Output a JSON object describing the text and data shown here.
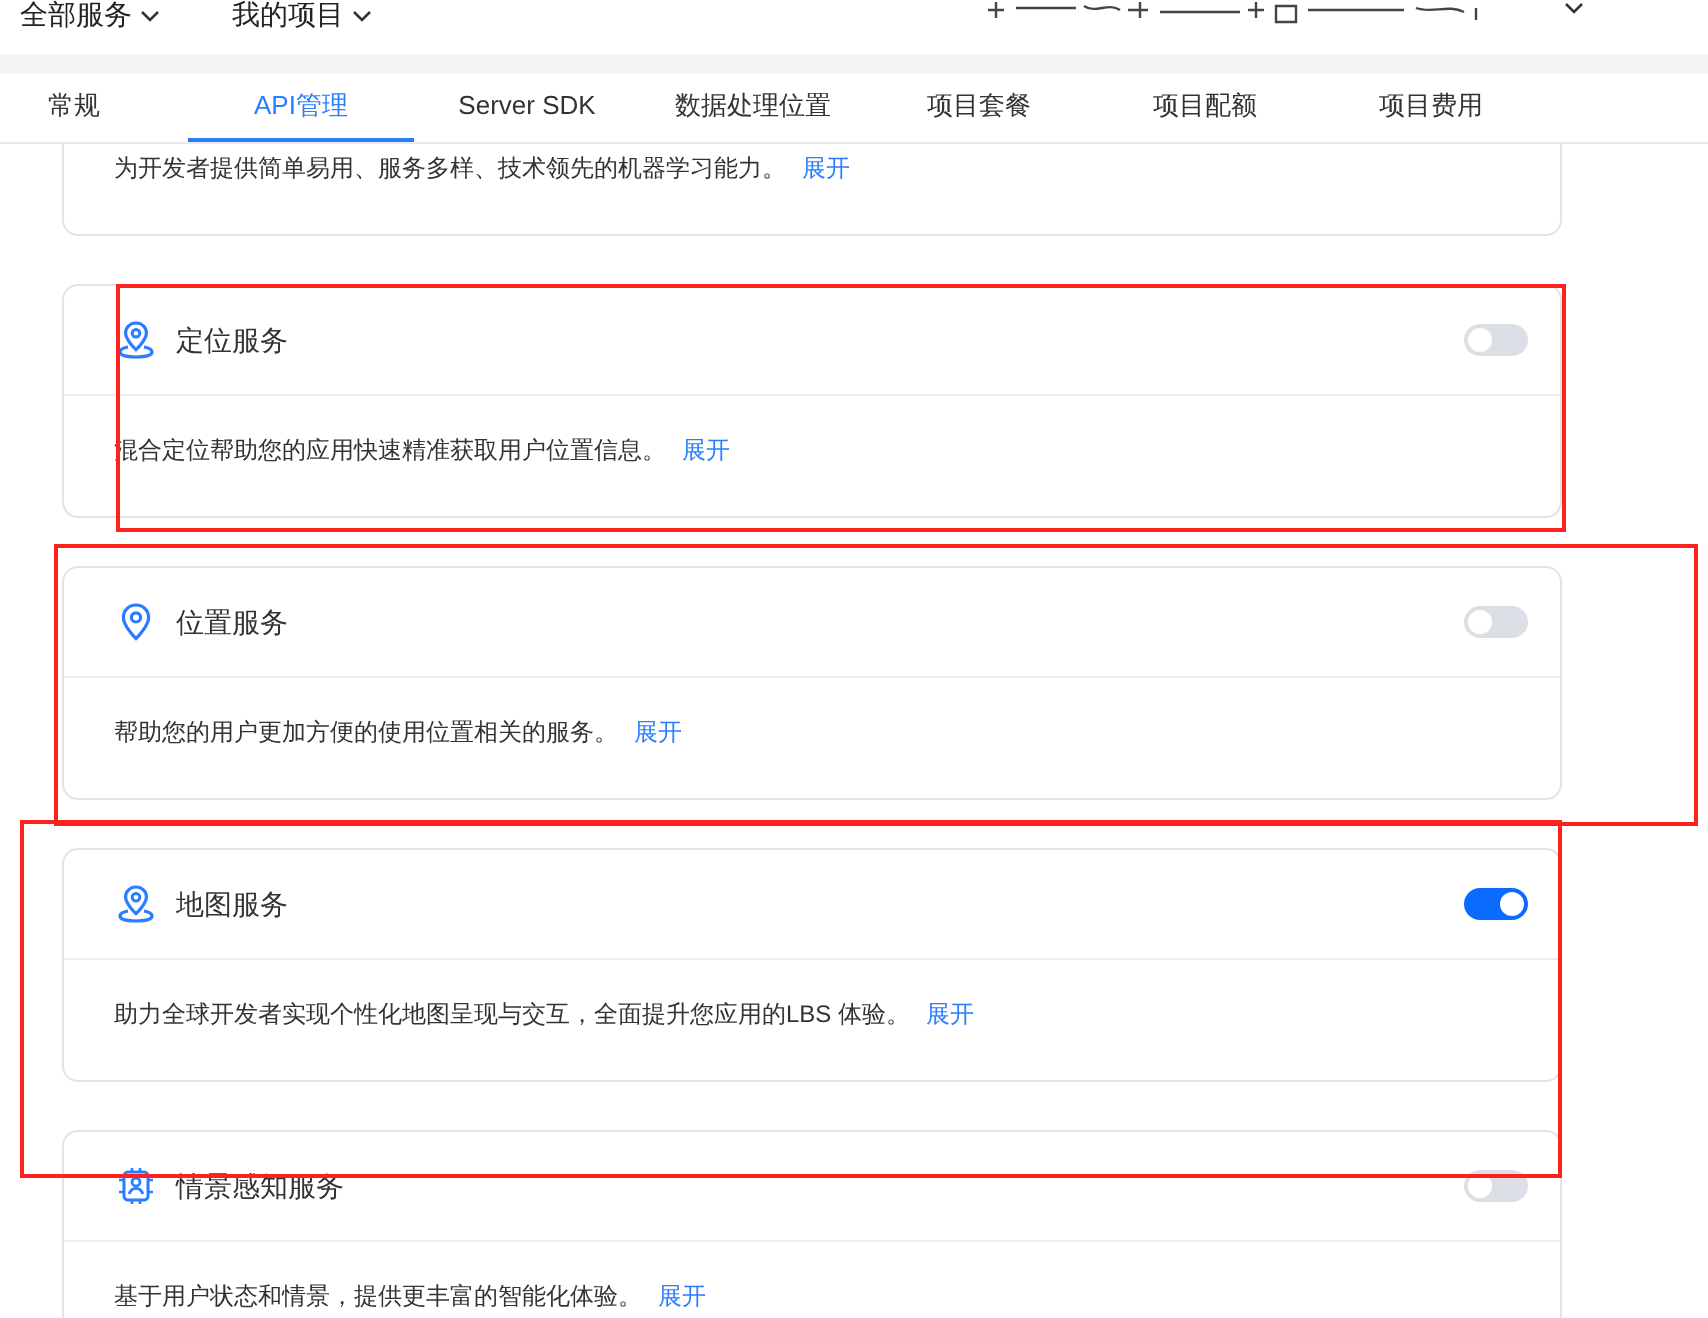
{
  "top_bar": {
    "menus": [
      {
        "label": "全部服务"
      },
      {
        "label": "我的项目"
      }
    ]
  },
  "tabs": [
    {
      "label": "常规",
      "selected": false
    },
    {
      "label": "API管理",
      "selected": true
    },
    {
      "label": "Server SDK",
      "selected": false
    },
    {
      "label": "数据处理位置",
      "selected": false
    },
    {
      "label": "项目套餐",
      "selected": false
    },
    {
      "label": "项目配额",
      "selected": false
    },
    {
      "label": "项目费用",
      "selected": false
    }
  ],
  "services": [
    {
      "kind": "partial",
      "description": "为开发者提供简单易用、服务多样、技术领先的机器学习能力。",
      "link": "展开"
    },
    {
      "kind": "full",
      "title": "定位服务",
      "on": false,
      "description": "混合定位帮助您的应用快速精准获取用户位置信息。",
      "link": "展开"
    },
    {
      "kind": "full",
      "title": "位置服务",
      "on": false,
      "description": "帮助您的用户更加方便的使用位置相关的服务。",
      "link": "展开"
    },
    {
      "kind": "full",
      "title": "地图服务",
      "on": true,
      "description": "助力全球开发者实现个性化地图呈现与交互，全面提升您应用的LBS 体验。",
      "link": "展开"
    },
    {
      "kind": "full",
      "title": "情景感知服务",
      "on": false,
      "description": "基于用户状态和情景，提供更丰富的智能化体验。",
      "link": "展开"
    }
  ]
}
